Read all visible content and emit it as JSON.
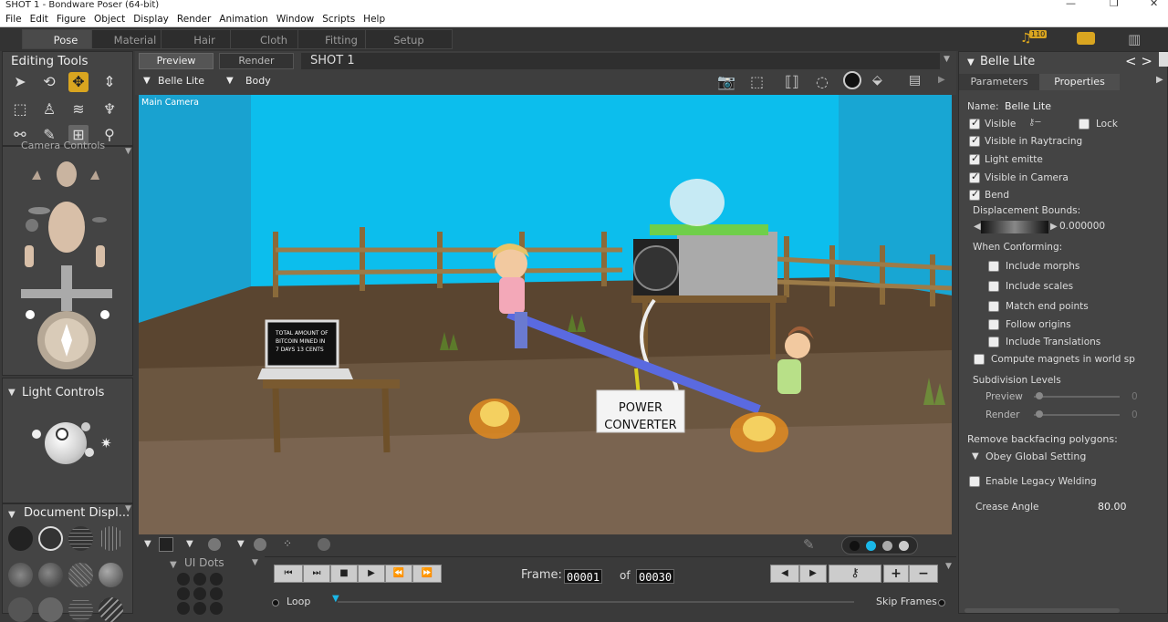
{
  "window": {
    "title": "SHOT 1 - Bondware Poser (64-bit)"
  },
  "menu": [
    "File",
    "Edit",
    "Figure",
    "Object",
    "Display",
    "Render",
    "Animation",
    "Window",
    "Scripts",
    "Help"
  ],
  "rooms": [
    "Pose",
    "Material",
    "Hair",
    "Cloth",
    "Fitting",
    "Setup"
  ],
  "topright": {
    "badge": "110"
  },
  "editing": {
    "title": "Editing Tools",
    "camera_controls": "Camera Controls"
  },
  "viewtabs": {
    "preview": "Preview",
    "render": "Render",
    "shot": "SHOT 1"
  },
  "selectors": {
    "figure": "Belle Lite",
    "part": "Body"
  },
  "viewport": {
    "camera": "Main Camera",
    "laptop_text": [
      "TOTAL AMOUNT OF",
      "BITCOIN MINED IN",
      "7 DAYS    13 CENTS"
    ],
    "box_text": [
      "POWER",
      "CONVERTER"
    ]
  },
  "light": {
    "title": "Light Controls"
  },
  "document": {
    "title": "Document  Displ..."
  },
  "uidots": {
    "title": "UI Dots"
  },
  "animation": {
    "frame_label": "Frame:",
    "frame": "00001",
    "of": "of",
    "total": "00030",
    "loop": "Loop",
    "skip": "Skip Frames"
  },
  "props": {
    "header": "Belle Lite",
    "tabs": [
      "Parameters",
      "Properties"
    ],
    "name_label": "Name:",
    "name_value": "Belle Lite",
    "visible": "Visible",
    "lock": "Lock",
    "vis_ray": "Visible in Raytracing",
    "light_emit": "Light emitte",
    "vis_cam": "Visible in Camera",
    "bend": "Bend",
    "disp_label": "Displacement Bounds:",
    "disp_value": "0.000000",
    "conform_label": "When Conforming:",
    "inc_morphs": "Include morphs",
    "inc_scales": "Include scales",
    "match_end": "Match end points",
    "follow": "Follow origins",
    "inc_trans": "Include Translations",
    "magnets": "Compute magnets in world sp",
    "subdiv": "Subdivision Levels",
    "preview": "Preview",
    "render": "Render",
    "preview_val": "0",
    "render_val": "0",
    "backface": "Remove backfacing polygons:",
    "obey": "Obey Global Setting",
    "legacy": "Enable Legacy Welding",
    "crease_label": "Crease Angle",
    "crease_value": "80.00"
  }
}
